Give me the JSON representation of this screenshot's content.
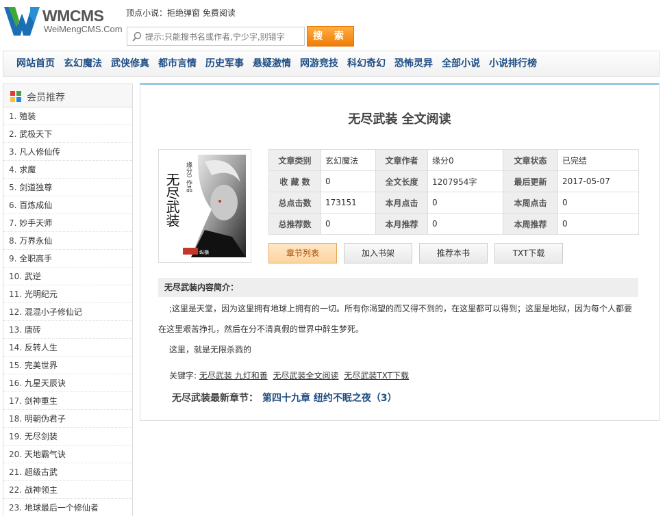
{
  "header": {
    "logo_title": "WMCMS",
    "logo_sub": "WeiMengCMS.Com",
    "slogan": "顶点小说：拒绝弹窗 免费阅读",
    "search_placeholder": "提示:只能搜书名或作者,宁少字,别错字",
    "search_button": "搜 索"
  },
  "nav": [
    "网站首页",
    "玄幻魔法",
    "武侠修真",
    "都市言情",
    "历史军事",
    "悬疑激情",
    "网游竞技",
    "科幻奇幻",
    "恐怖灵异",
    "全部小说",
    "小说排行榜"
  ],
  "sidebar": {
    "title": "会员推荐",
    "items": [
      {
        "num": "1.",
        "name": "殖装"
      },
      {
        "num": "2.",
        "name": "武极天下"
      },
      {
        "num": "3.",
        "name": "凡人修仙传"
      },
      {
        "num": "4.",
        "name": "求魔"
      },
      {
        "num": "5.",
        "name": "剑道独尊"
      },
      {
        "num": "6.",
        "name": "百炼成仙"
      },
      {
        "num": "7.",
        "name": "妙手天师"
      },
      {
        "num": "8.",
        "name": "万界永仙"
      },
      {
        "num": "9.",
        "name": "全职高手"
      },
      {
        "num": "10.",
        "name": "武逆"
      },
      {
        "num": "11.",
        "name": "光明纪元"
      },
      {
        "num": "12.",
        "name": "混混小子修仙记"
      },
      {
        "num": "13.",
        "name": "唐砖"
      },
      {
        "num": "14.",
        "name": "反转人生"
      },
      {
        "num": "15.",
        "name": "完美世界"
      },
      {
        "num": "16.",
        "name": "九星天辰诀"
      },
      {
        "num": "17.",
        "name": "剑神重生"
      },
      {
        "num": "18.",
        "name": "明朝伪君子"
      },
      {
        "num": "19.",
        "name": "无尽剑装"
      },
      {
        "num": "20.",
        "name": "天地霸气诀"
      },
      {
        "num": "21.",
        "name": "超级古武"
      },
      {
        "num": "22.",
        "name": "战神领主"
      },
      {
        "num": "23.",
        "name": "地球最后一个修仙者"
      }
    ]
  },
  "book": {
    "title": "无尽武装 全文阅读",
    "cover_text": "无尽武装",
    "cover_author": "缘分0 作品",
    "cover_publisher": "纵横",
    "info": [
      [
        {
          "k": "文章类别",
          "v": "玄幻魔法"
        },
        {
          "k": "文章作者",
          "v": "缘分0"
        },
        {
          "k": "文章状态",
          "v": "已完结"
        }
      ],
      [
        {
          "k": "收 藏 数",
          "v": "0"
        },
        {
          "k": "全文长度",
          "v": "1207954字"
        },
        {
          "k": "最后更新",
          "v": "2017-05-07"
        }
      ],
      [
        {
          "k": "总点击数",
          "v": "173151"
        },
        {
          "k": "本月点击",
          "v": "0"
        },
        {
          "k": "本周点击",
          "v": "0"
        }
      ],
      [
        {
          "k": "总推荐数",
          "v": "0"
        },
        {
          "k": "本月推荐",
          "v": "0"
        },
        {
          "k": "本周推荐",
          "v": "0"
        }
      ]
    ],
    "buttons": [
      "章节列表",
      "加入书架",
      "推荐本书",
      "TXT下载"
    ],
    "intro_head": "无尽武装内容简介：",
    "intro_p1": ";这里是天堂，因为这里拥有地球上拥有的一切。所有你渴望的而又得不到的，在这里都可以得到；这里是地狱，因为每个人都要在这里艰苦挣扎，然后在分不清真假的世界中醉生梦死。",
    "intro_p2": "这里，就是无限杀戮的",
    "keywords_label": "关键字:",
    "keywords": [
      "无尽武装 九灯和善",
      "无尽武装全文阅读",
      "无尽武装TXT下载"
    ],
    "latest_label": "无尽武装最新章节：",
    "latest_chapter": "第四十九章 纽约不眠之夜（3）"
  },
  "colors": {
    "nav_text": "#1f4e84",
    "search_button": "#f07c0a",
    "main_top_border": "#9cc8e8"
  }
}
